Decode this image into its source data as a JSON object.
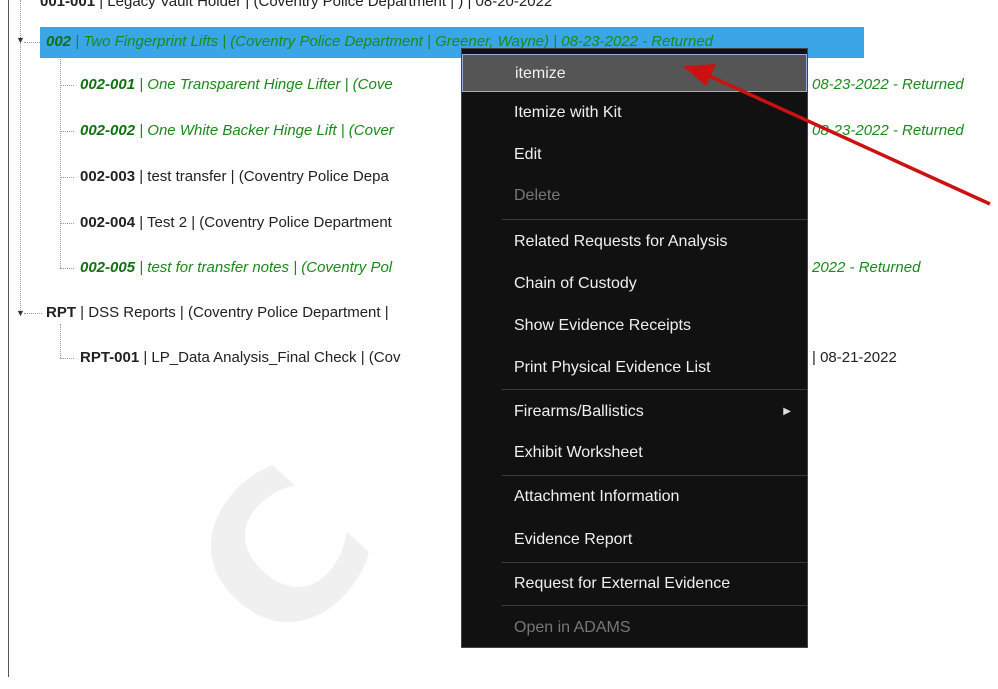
{
  "tree": {
    "top_partial": {
      "code": "001-001",
      "text": " | Legacy Vault Holder | (Coventry Police Department | ) | 08-20-2022"
    },
    "rows": [
      {
        "code": "002",
        "text": " | Two Fingerprint Lifts | (Coventry Police Department | Greener, Wayne) | 08-23-2022 - Returned",
        "green": true,
        "selected": true
      },
      {
        "code": "002-001",
        "text": " | One Transparent Hinge Lifter | (Cove",
        "right": "08-23-2022 - Returned",
        "green": true
      },
      {
        "code": "002-002",
        "text": " | One White Backer Hinge Lift | (Cover",
        "right": "08-23-2022 - Returned",
        "green": true
      },
      {
        "code": "002-003",
        "text": " | test transfer | (Coventry Police Depa",
        "green": false
      },
      {
        "code": "002-004",
        "text": " | Test 2 | (Coventry Police Department",
        "green": false
      },
      {
        "code": "002-005",
        "text": " | test for transfer notes | (Coventry Pol",
        "right": "2022 - Returned",
        "green": true
      },
      {
        "code": "RPT",
        "text": " | DSS Reports | (Coventry Police Department |",
        "green": false
      },
      {
        "code": "RPT-001",
        "text": " | LP_Data Analysis_Final Check | (Cov",
        "right": "| 08-21-2022",
        "green": false
      }
    ]
  },
  "context_menu": {
    "items": [
      {
        "label": "itemize",
        "state": "hover"
      },
      {
        "label": "Itemize with Kit"
      },
      {
        "label": "Edit"
      },
      {
        "label": "Delete",
        "state": "disabled"
      },
      {
        "label": "Related Requests for Analysis"
      },
      {
        "label": "Chain of Custody"
      },
      {
        "label": "Show Evidence Receipts"
      },
      {
        "label": "Print Physical Evidence List"
      },
      {
        "label": "Firearms/Ballistics",
        "submenu": true
      },
      {
        "label": "Exhibit Worksheet"
      },
      {
        "label": "Attachment Information"
      },
      {
        "label": "Evidence Report"
      },
      {
        "label": "Request for External Evidence"
      },
      {
        "label": "Open in ADAMS",
        "state": "disabled"
      }
    ]
  },
  "colors": {
    "selection": "#3aa6e8",
    "green_text": "#1a8a1a",
    "menu_bg": "#111111",
    "arrow": "#cc1111"
  }
}
